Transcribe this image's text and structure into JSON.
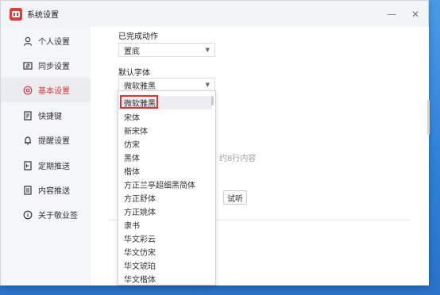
{
  "window": {
    "title": "系统设置"
  },
  "controls": {
    "minimize": "—",
    "close": "✕"
  },
  "sidebar": {
    "items": [
      {
        "label": "个人设置",
        "icon": "user-icon"
      },
      {
        "label": "同步设置",
        "icon": "sync-icon"
      },
      {
        "label": "基本设置",
        "icon": "settings-icon",
        "active": true
      },
      {
        "label": "快捷键",
        "icon": "keyboard-icon"
      },
      {
        "label": "提醒设置",
        "icon": "bell-icon"
      },
      {
        "label": "定期推送",
        "icon": "schedule-icon"
      },
      {
        "label": "内容推送",
        "icon": "content-icon"
      },
      {
        "label": "关于敬业签",
        "icon": "info-icon"
      }
    ]
  },
  "main": {
    "completed_action_label": "已完成动作",
    "completed_action_value": "置底",
    "default_font_label": "默认字体",
    "default_font_value": "微软雅黑",
    "line_text": "约8行内容",
    "test_button": "试听"
  },
  "font_dropdown": {
    "options": [
      "微软雅黑",
      "宋体",
      "新宋体",
      "仿宋",
      "黑体",
      "楷体",
      "方正兰亭超细黑简体",
      "方正舒体",
      "方正姚体",
      "隶书",
      "华文彩云",
      "华文仿宋",
      "华文琥珀",
      "华文楷体"
    ],
    "selected": "微软雅黑"
  },
  "colors": {
    "accent": "#e0383c",
    "logo": "#e23a3a",
    "highlight_border": "#e53030"
  }
}
